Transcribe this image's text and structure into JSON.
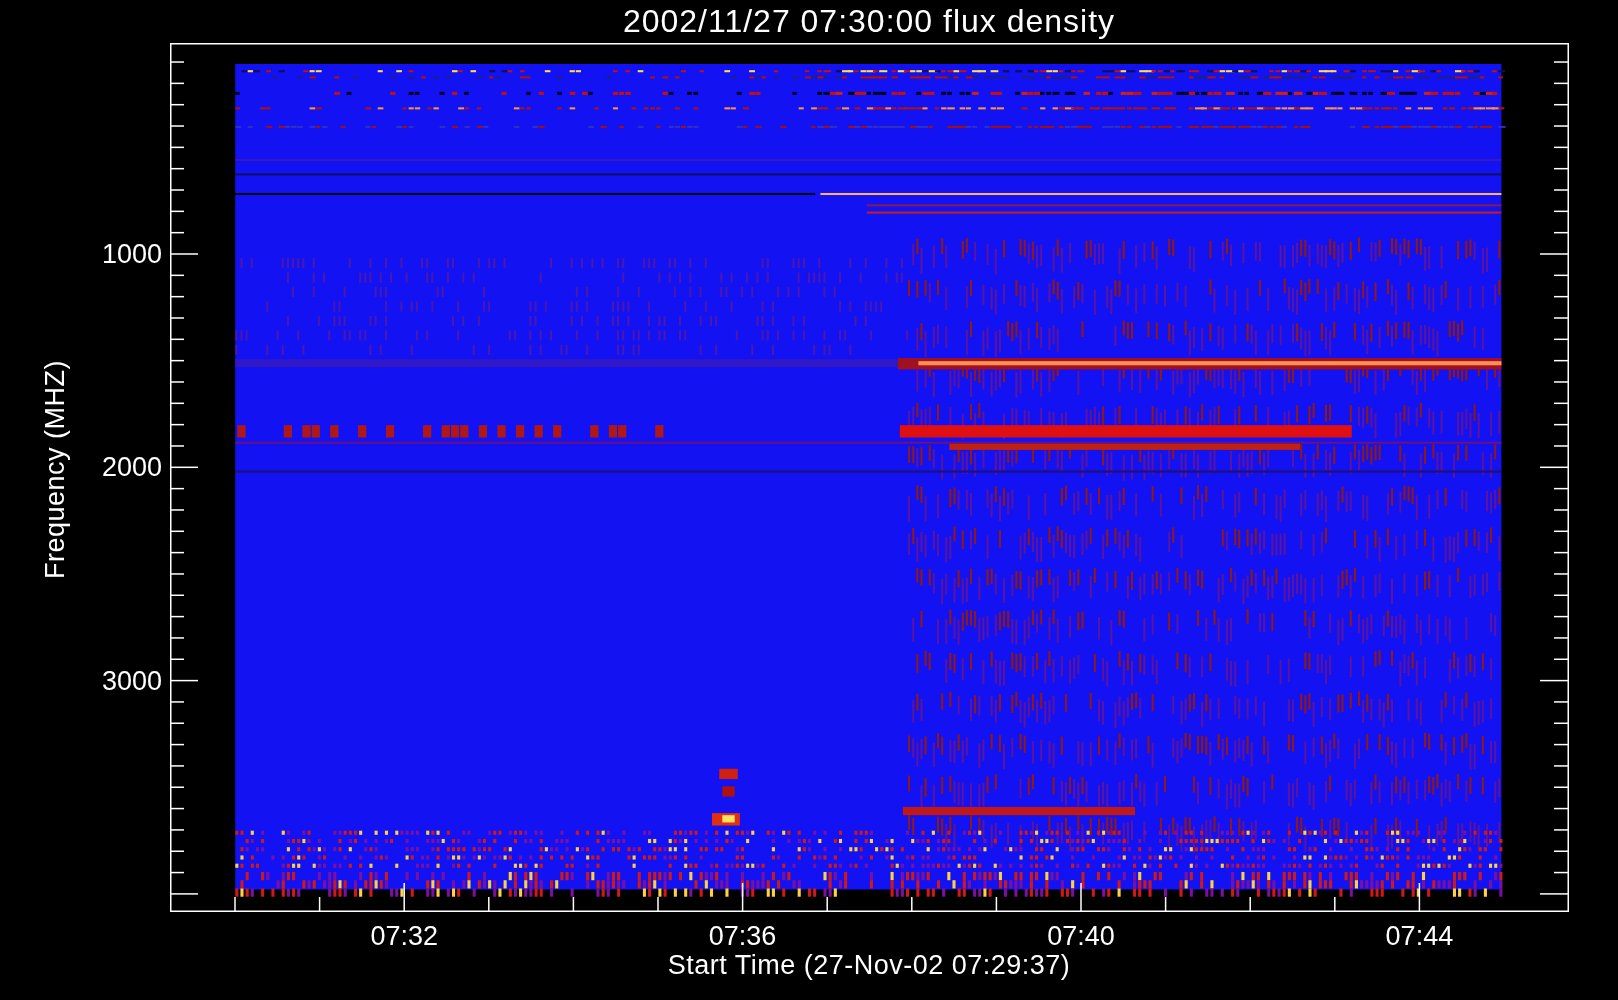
{
  "plot": {
    "title": "2002/11/27 07:30:00 flux density",
    "y_axis": {
      "label": "Frequency (MHZ)",
      "ticks": [
        "1000",
        "2000",
        "3000"
      ]
    },
    "x_axis": {
      "label": "Start Time (27-Nov-02 07:29:37)",
      "ticks": [
        "07:32",
        "07:36",
        "07:40",
        "07:44"
      ]
    }
  }
}
